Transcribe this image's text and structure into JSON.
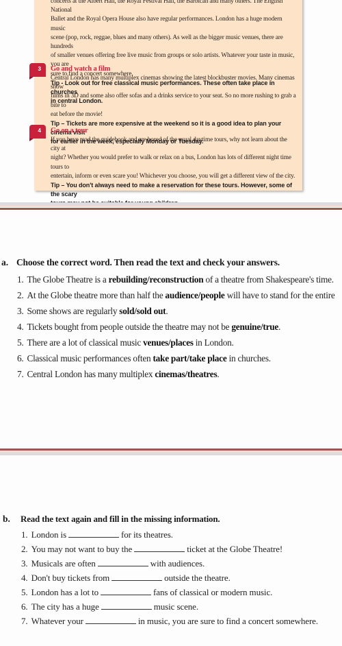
{
  "article": {
    "music_section": {
      "lines": [
        "concerts at the Albert Hall, the Royal Festival Hall, the Barbican and many others. The English National",
        "Ballet and the Royal Opera House also have regular performances. London has a huge modern music",
        "scene (pop, rock, reggae, blues and many others). As well as the bigger music venues, there are hundreds",
        "of smaller venues offering free live music from groups or solo artists. Whatever your taste in music, you are",
        "sure to find a concert somewhere."
      ],
      "tip_lines": [
        "Tip - Look out for free classical music performances. These often take place in churches",
        "in central London."
      ]
    },
    "sections": [
      {
        "number": "3",
        "title": "Go and watch a film",
        "lines": [
          "Central London has many multiplex cinemas showing the latest blockbuster movies. Many cinemas show",
          "films in 3D and some also offer sofas and a drinks service to your seat. So no more rushing to grab a bite to",
          "eat before the movie!"
        ],
        "tip_lines": [
          "Tip – Tickets are more expensive at the weekend so it is a good idea to plan your cinema visit",
          "for earlier in the week, especially Monday or Tuesday."
        ]
      },
      {
        "number": "4",
        "title": "Go on a tour",
        "lines": [
          "If you have read the guidebook and are bored of the usual daytime tours, why not learn about the city at",
          "night? Whether you would prefer to walk or relax on a bus, London has lots of different night time tours to",
          "entertain, inform or even scare you! Whichever you choose, you will get a different view of the city."
        ],
        "tip_lines": [
          "Tip – You don't always need to make a reservation for these tours. However, some of the scary",
          "tours may not be suitable for young children."
        ]
      }
    ],
    "colors": {
      "panel_bg": "#fde3c8",
      "accent_red": "#c9203c",
      "divider": "#9a5a50"
    }
  },
  "exercise_a": {
    "letter": "a.",
    "instruction": "Choose the correct word. Then read the text and check your answers.",
    "items": [
      {
        "num": "1.",
        "before": "The Globe Theatre is a ",
        "choice": "rebuilding/reconstruction",
        "after": " of a theatre from Shakespeare's time."
      },
      {
        "num": "2.",
        "before": "At the Globe theatre more than half the ",
        "choice": "audience/people",
        "after": " will have to stand for the entire"
      },
      {
        "num": "3.",
        "before": "Some shows are regularly ",
        "choice": "sold/sold out",
        "after": "."
      },
      {
        "num": "4.",
        "before": "Tickets bought from people outside the theatre may not be ",
        "choice": "genuine/true",
        "after": "."
      },
      {
        "num": "5.",
        "before": "There are a lot of classical music ",
        "choice": "venues/places",
        "after": " in London."
      },
      {
        "num": "6.",
        "before": "Classical music performances often ",
        "choice": "take part/take place",
        "after": " in churches."
      },
      {
        "num": "7.",
        "before": "Central London has many multiplex ",
        "choice": "cinemas/theatres",
        "after": "."
      }
    ]
  },
  "exercise_b": {
    "letter": "b.",
    "instruction": "Read the text again and fill in the missing information.",
    "items": [
      {
        "num": "1.",
        "before": "London is",
        "after": "for its theatres."
      },
      {
        "num": "2.",
        "before": "You may not want to buy the",
        "after": "ticket at the Globe Theatre!"
      },
      {
        "num": "3.",
        "before": "Musicals are often",
        "after": "with audiences."
      },
      {
        "num": "4.",
        "before": "Don't buy tickets from",
        "after": "outside the theatre."
      },
      {
        "num": "5.",
        "before": "London has a lot to",
        "after": "fans of classical or modern music."
      },
      {
        "num": "6.",
        "before": "The city has a huge",
        "after": "music scene."
      },
      {
        "num": "7.",
        "before": "Whatever your",
        "after": "in music, you are sure to find a concert somewhere."
      }
    ]
  }
}
